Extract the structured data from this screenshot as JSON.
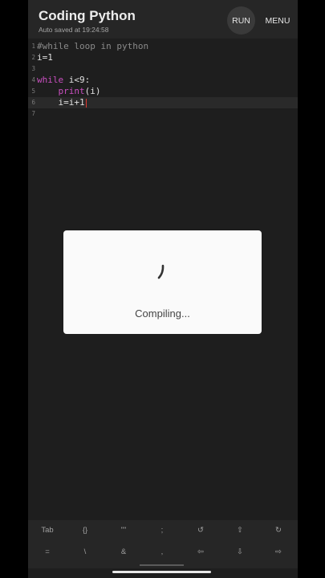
{
  "app": {
    "title": "Coding Python",
    "autosave": "Auto saved at 19:24:58",
    "run_label": "RUN",
    "menu_label": "MENU"
  },
  "editor": {
    "lines": [
      {
        "number": "1",
        "text": "#while loop in python"
      },
      {
        "number": "2",
        "text": "i=1"
      },
      {
        "number": "3",
        "text": ""
      },
      {
        "number": "4",
        "text": "while i<9:"
      },
      {
        "number": "5",
        "text": "    print(i)"
      },
      {
        "number": "6",
        "text": "    i=i+1"
      },
      {
        "number": "7",
        "text": ""
      }
    ],
    "tokens": {
      "l1": "#while loop in python",
      "l2": "i=1",
      "l4_kw": "while",
      "l4_rest": " i<9:",
      "l5_indent": "    ",
      "l5_fn": "print",
      "l5_rest": "(i)",
      "l6": "    i=i+1"
    },
    "colors": {
      "keyword": "#c94fc0",
      "comment": "#8a8a8a",
      "caret": "#e0382f"
    }
  },
  "dialog": {
    "message": "Compiling..."
  },
  "keyboard_bar": {
    "row1": [
      "Tab",
      "{}",
      "\"\"",
      ";",
      "↺",
      "⇧",
      "↻"
    ],
    "row2": [
      "=",
      "\\",
      "&",
      ",",
      "⇦",
      "⇩",
      "⇨"
    ]
  }
}
